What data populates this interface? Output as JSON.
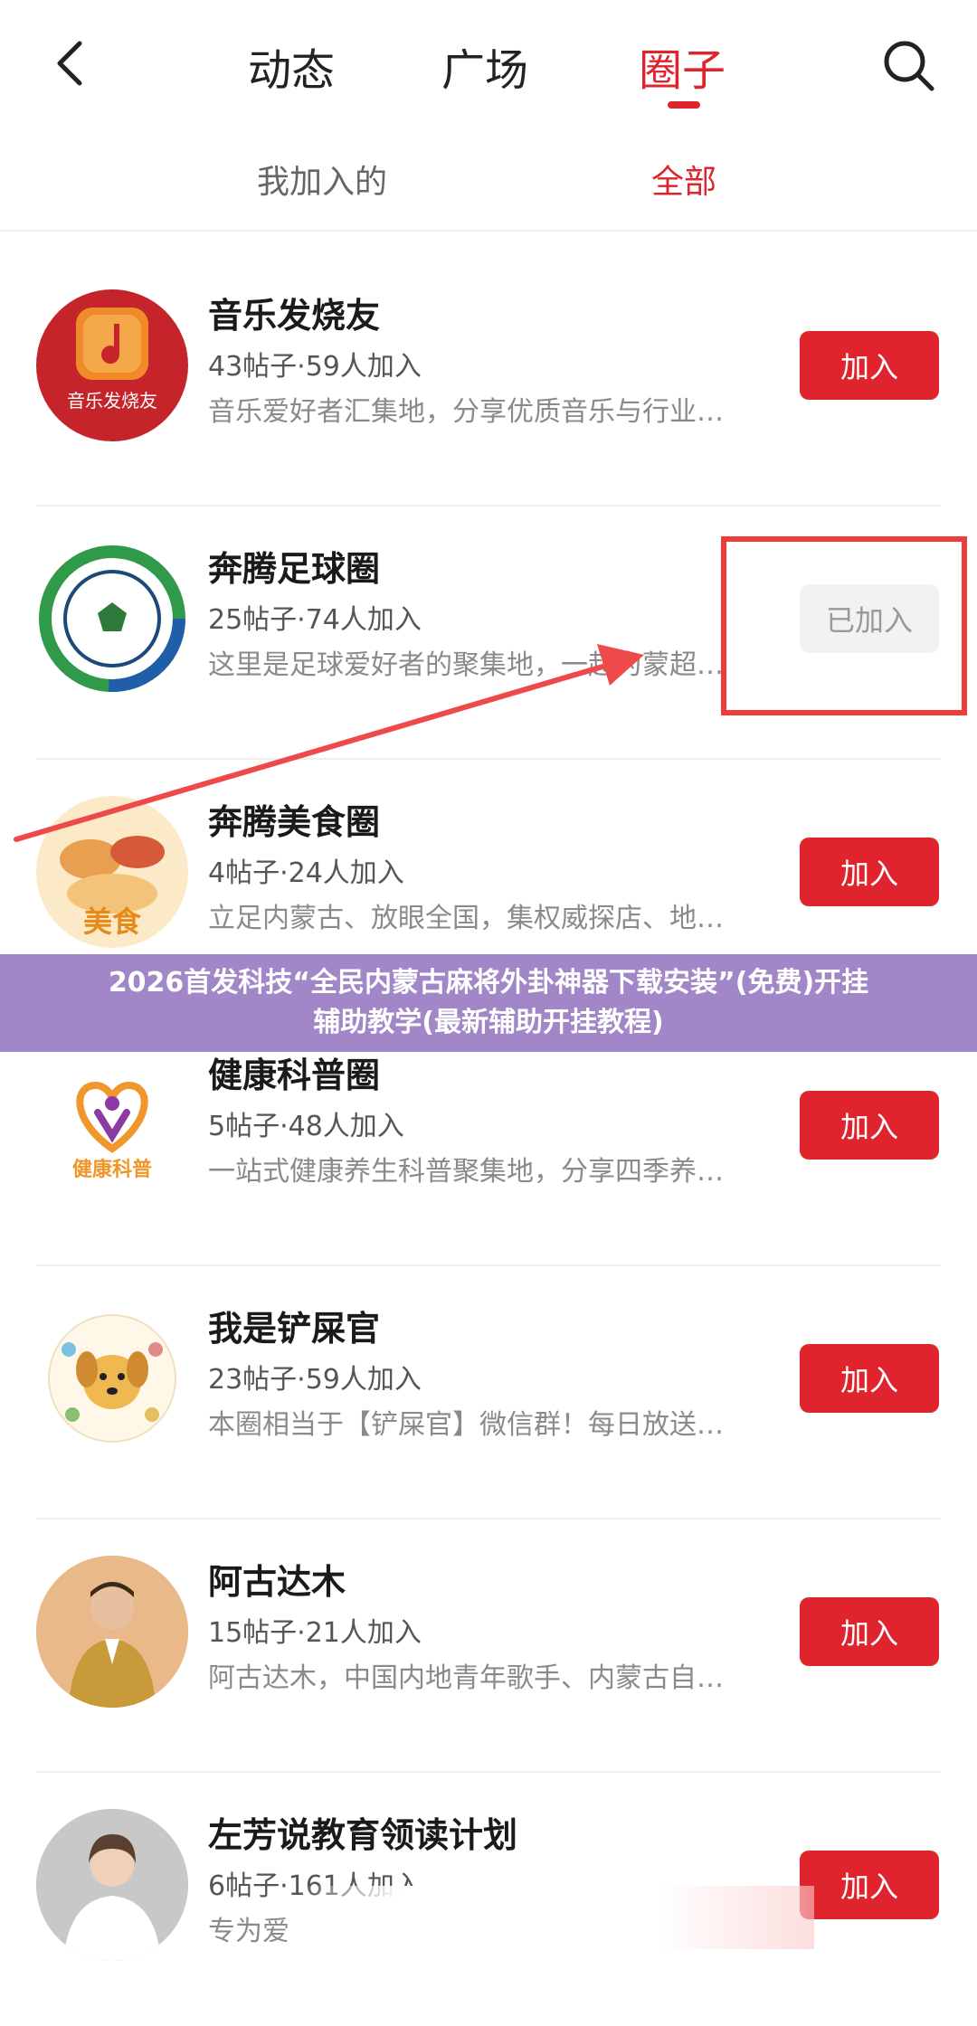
{
  "header": {
    "tabs": [
      {
        "label": "动态"
      },
      {
        "label": "广场"
      },
      {
        "label": "圈子"
      }
    ],
    "active_tab": "圈子"
  },
  "subtabs": [
    {
      "label": "我加入的"
    },
    {
      "label": "全部"
    }
  ],
  "circles": [
    {
      "name": "音乐发烧友",
      "stats": "43帖子·59人加入",
      "desc": "音乐爱好者汇集地，分享优质音乐与行业…",
      "button": "加入",
      "avatar_text": "音乐发烧友"
    },
    {
      "name": "奔腾足球圈",
      "stats": "25帖子·74人加入",
      "desc": "这里是足球爱好者的聚集地，一起为蒙超…",
      "button": "已加入"
    },
    {
      "name": "奔腾美食圈",
      "stats": "4帖子·24人加入",
      "desc": "立足内蒙古、放眼全国，集权威探店、地…",
      "button": "加入",
      "avatar_text": "美食"
    },
    {
      "name": "健康科普圈",
      "stats": "5帖子·48人加入",
      "desc": "一站式健康养生科普聚集地，分享四季养…",
      "button": "加入",
      "avatar_text": "健康科普"
    },
    {
      "name": "我是铲屎官",
      "stats": "23帖子·59人加入",
      "desc": "本圈相当于【铲屎官】微信群！每日放送…",
      "button": "加入"
    },
    {
      "name": "阿古达木",
      "stats": "15帖子·21人加入",
      "desc": "阿古达木，中国内地青年歌手、内蒙古自…",
      "button": "加入"
    },
    {
      "name": "左芳说教育领读计划",
      "stats": "6帖子·161人加入",
      "desc": "专为爱",
      "button": "加入"
    }
  ],
  "banner": {
    "line1": "2026首发科技“全民内蒙古麻将外卦神器下载安装”(免费)开挂",
    "line2": "辅助教学(最新辅助开挂教程)"
  },
  "colors": {
    "accent": "#e0242e",
    "banner": "#a287c8"
  }
}
